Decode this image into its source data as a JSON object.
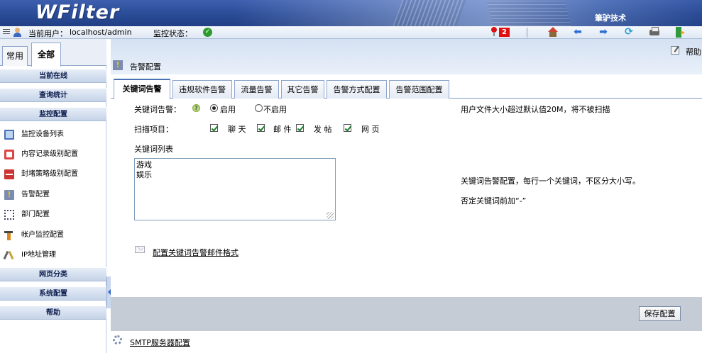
{
  "header": {
    "logo": "WFilter",
    "company": "筆驴技术"
  },
  "statusbar": {
    "current_user_label": "当前用户：",
    "current_user": "localhost/admin",
    "monitor_status_label": "监控状态：",
    "alarm_count": "2",
    "icons": [
      "menu-icon",
      "user-icon",
      "status-ok-icon",
      "alarm-pin-icon",
      "home-icon",
      "back-arrow-icon",
      "forward-arrow-icon",
      "refresh-icon",
      "print-icon",
      "exit-icon"
    ]
  },
  "sidebar": {
    "tabs": [
      {
        "label": "常用"
      },
      {
        "label": "全部"
      }
    ],
    "sections": [
      {
        "label": "当前在线"
      },
      {
        "label": "查询统计"
      },
      {
        "label": "监控配置"
      },
      {
        "label": "网页分类"
      },
      {
        "label": "系统配置"
      },
      {
        "label": "帮助"
      }
    ],
    "items": [
      {
        "label": "监控设备列表",
        "icon": "monitor-icon"
      },
      {
        "label": "内容记录级别配置",
        "icon": "content-record-icon"
      },
      {
        "label": "封堵策略级别配置",
        "icon": "block-policy-icon"
      },
      {
        "label": "告警配置",
        "icon": "alert-icon"
      },
      {
        "label": "部门配置",
        "icon": "department-icon"
      },
      {
        "label": "帐户监控配置",
        "icon": "account-icon"
      },
      {
        "label": "IP地址管理",
        "icon": "ip-tools-icon"
      }
    ]
  },
  "main": {
    "help": "帮助",
    "page_title": "告警配置",
    "tabs": [
      {
        "label": "关键词告警",
        "active": true
      },
      {
        "label": "违规软件告警"
      },
      {
        "label": "流量告警"
      },
      {
        "label": "其它告警"
      },
      {
        "label": "告警方式配置"
      },
      {
        "label": "告警范围配置"
      }
    ],
    "keyword_alert_label": "关键词告警：",
    "enable_label": "启用",
    "disable_label": "不启用",
    "enabled": true,
    "scan_items_label": "扫描项目：",
    "scan_items": [
      {
        "label": "聊 天",
        "checked": true
      },
      {
        "label": "邮 件",
        "checked": true
      },
      {
        "label": "发 帖",
        "checked": true
      },
      {
        "label": "网 页",
        "checked": true
      }
    ],
    "keyword_list_label": "关键词列表",
    "keywords": "游戏\n娱乐",
    "file_size_note": "用户文件大小超过默认值20M，将不被扫描",
    "keyword_help_1": "关键词告警配置，每行一个关键词，不区分大小写。",
    "keyword_help_2": "否定关键词前加“-”",
    "mail_format_link": "配置关键词告警邮件格式",
    "save_label": "保存配置",
    "smtp_link": "SMTP服务器配置"
  }
}
